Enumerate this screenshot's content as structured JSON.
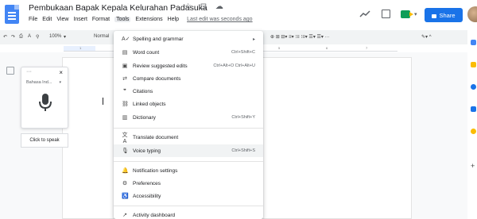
{
  "doc": {
    "title": "Pembukaan Bapak Kepala Kelurahan Padasuka",
    "title_icons": "☆ ⊡ ☁"
  },
  "menubar": {
    "items": [
      "File",
      "Edit",
      "View",
      "Insert",
      "Format",
      "Tools",
      "Extensions",
      "Help"
    ],
    "last_edit": "Last edit was seconds ago"
  },
  "header": {
    "share_label": "Share"
  },
  "toolbar": {
    "zoom": "100%",
    "style": "Normal",
    "undo": "↶",
    "redo": "↷",
    "print": "⎙",
    "spell": "A",
    "paint": "⚲",
    "zoom_caret": "▾",
    "right_tools": "⊕ ⊞ ⊟▾  ≡▾  ⁝≡  ⁝≡▾ ☰▾ ☰▾ ···",
    "edit_tools": "✎▾  ^"
  },
  "ruler": {
    "marks": [
      "1",
      "2",
      "3",
      "4",
      "5",
      "6",
      "7"
    ]
  },
  "voice_widget": {
    "dots": "···",
    "close": "×",
    "language": "Bahasa Ind...",
    "language_caret": "▾",
    "tooltip": "Click to speak"
  },
  "tools_menu": {
    "items": [
      {
        "icon": "spelling-icon",
        "glyph": "A✓",
        "label": "Spelling and grammar",
        "shortcut": "",
        "submenu": true
      },
      {
        "icon": "word-count-icon",
        "glyph": "▤",
        "label": "Word count",
        "shortcut": "Ctrl+Shift+C",
        "submenu": false
      },
      {
        "icon": "review-edits-icon",
        "glyph": "▣",
        "label": "Review suggested edits",
        "shortcut": "Ctrl+Alt+O Ctrl+Alt+U",
        "submenu": false
      },
      {
        "icon": "compare-icon",
        "glyph": "⇄",
        "label": "Compare documents",
        "shortcut": "",
        "submenu": false
      },
      {
        "icon": "citations-icon",
        "glyph": "❞",
        "label": "Citations",
        "shortcut": "",
        "submenu": false
      },
      {
        "icon": "linked-objects-icon",
        "glyph": "⛓",
        "label": "Linked objects",
        "shortcut": "",
        "submenu": false
      },
      {
        "icon": "dictionary-icon",
        "glyph": "▥",
        "label": "Dictionary",
        "shortcut": "Ctrl+Shift+Y",
        "submenu": false
      },
      {
        "icon": "translate-icon",
        "glyph": "文A",
        "label": "Translate document",
        "shortcut": "",
        "submenu": false
      },
      {
        "icon": "microphone-icon",
        "glyph": "🎙",
        "label": "Voice typing",
        "shortcut": "Ctrl+Shift+S",
        "submenu": false
      },
      {
        "icon": "bell-icon",
        "glyph": "🔔",
        "label": "Notification settings",
        "shortcut": "",
        "submenu": false
      },
      {
        "icon": "preferences-icon",
        "glyph": "⚙",
        "label": "Preferences",
        "shortcut": "",
        "submenu": false
      },
      {
        "icon": "accessibility-icon",
        "glyph": "♿",
        "label": "Accessibility",
        "shortcut": "",
        "submenu": false
      },
      {
        "icon": "activity-icon",
        "glyph": "↗",
        "label": "Activity dashboard",
        "shortcut": "",
        "submenu": false
      }
    ],
    "submenu_arrow": "▸"
  },
  "colors": {
    "accent": "#1a73e8",
    "doc_blue": "#4285f4",
    "menu_highlight": "#f1f3f4"
  }
}
